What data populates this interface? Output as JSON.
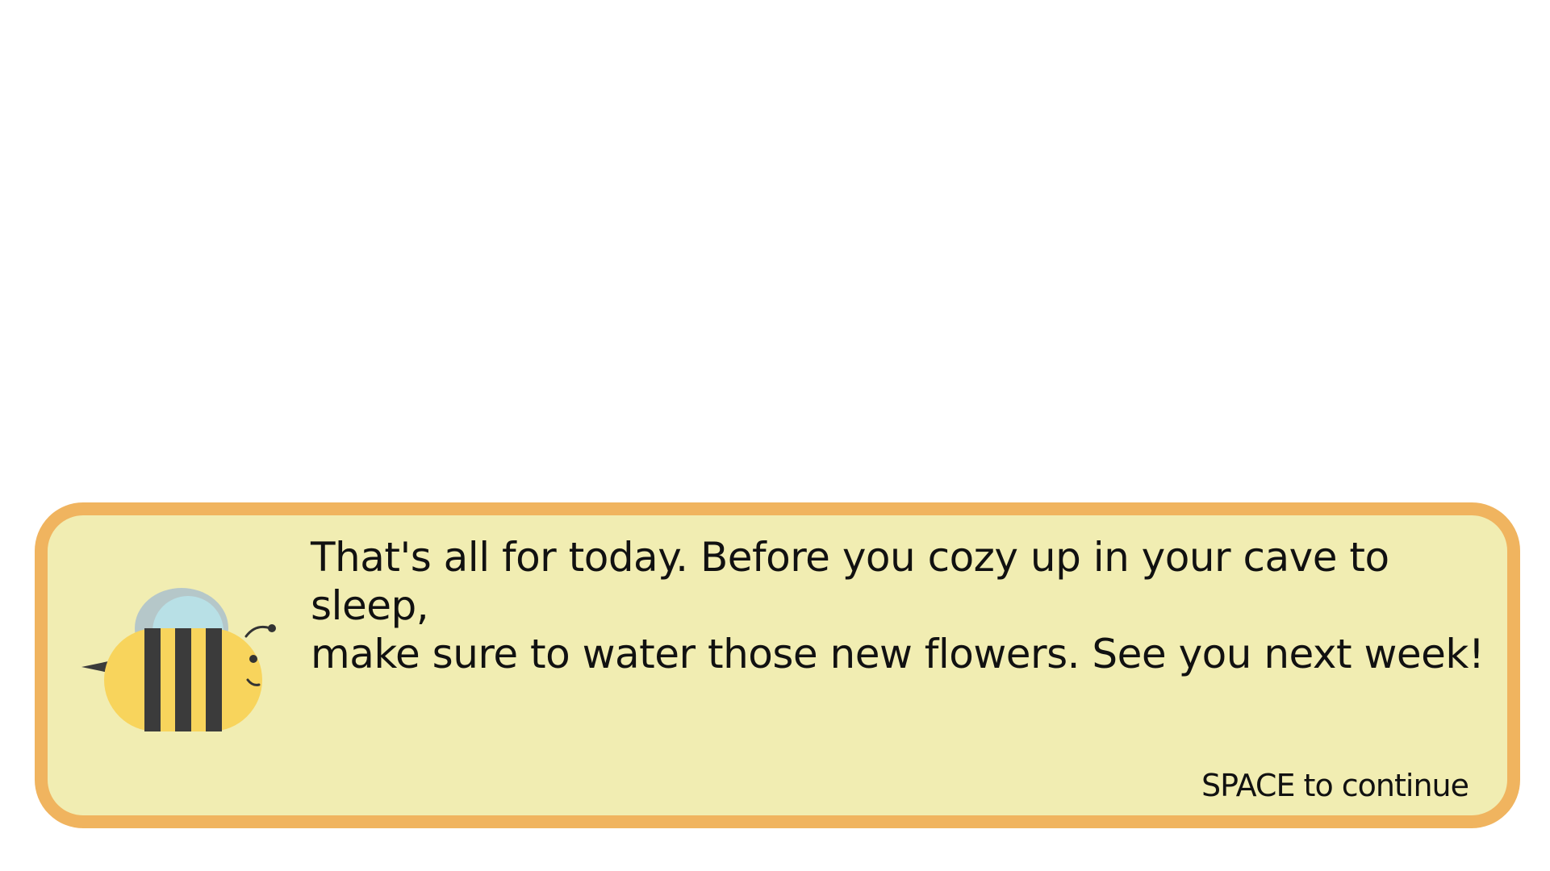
{
  "dialog": {
    "message": "That's all for today. Before you cozy up in your cave to sleep,\nmake sure to water those new flowers. See you next week!",
    "continue_hint": "SPACE to continue"
  },
  "speaker": {
    "icon": "bee-icon"
  },
  "colors": {
    "background": "#ffffff",
    "dialog_fill": "#f1edb2",
    "dialog_border": "#f0b45f",
    "bee_body": "#f8d45c",
    "bee_stripes": "#3b3b3b",
    "bee_wing": "#b8e0e6",
    "bee_wing_back": "#b5c7c9"
  }
}
